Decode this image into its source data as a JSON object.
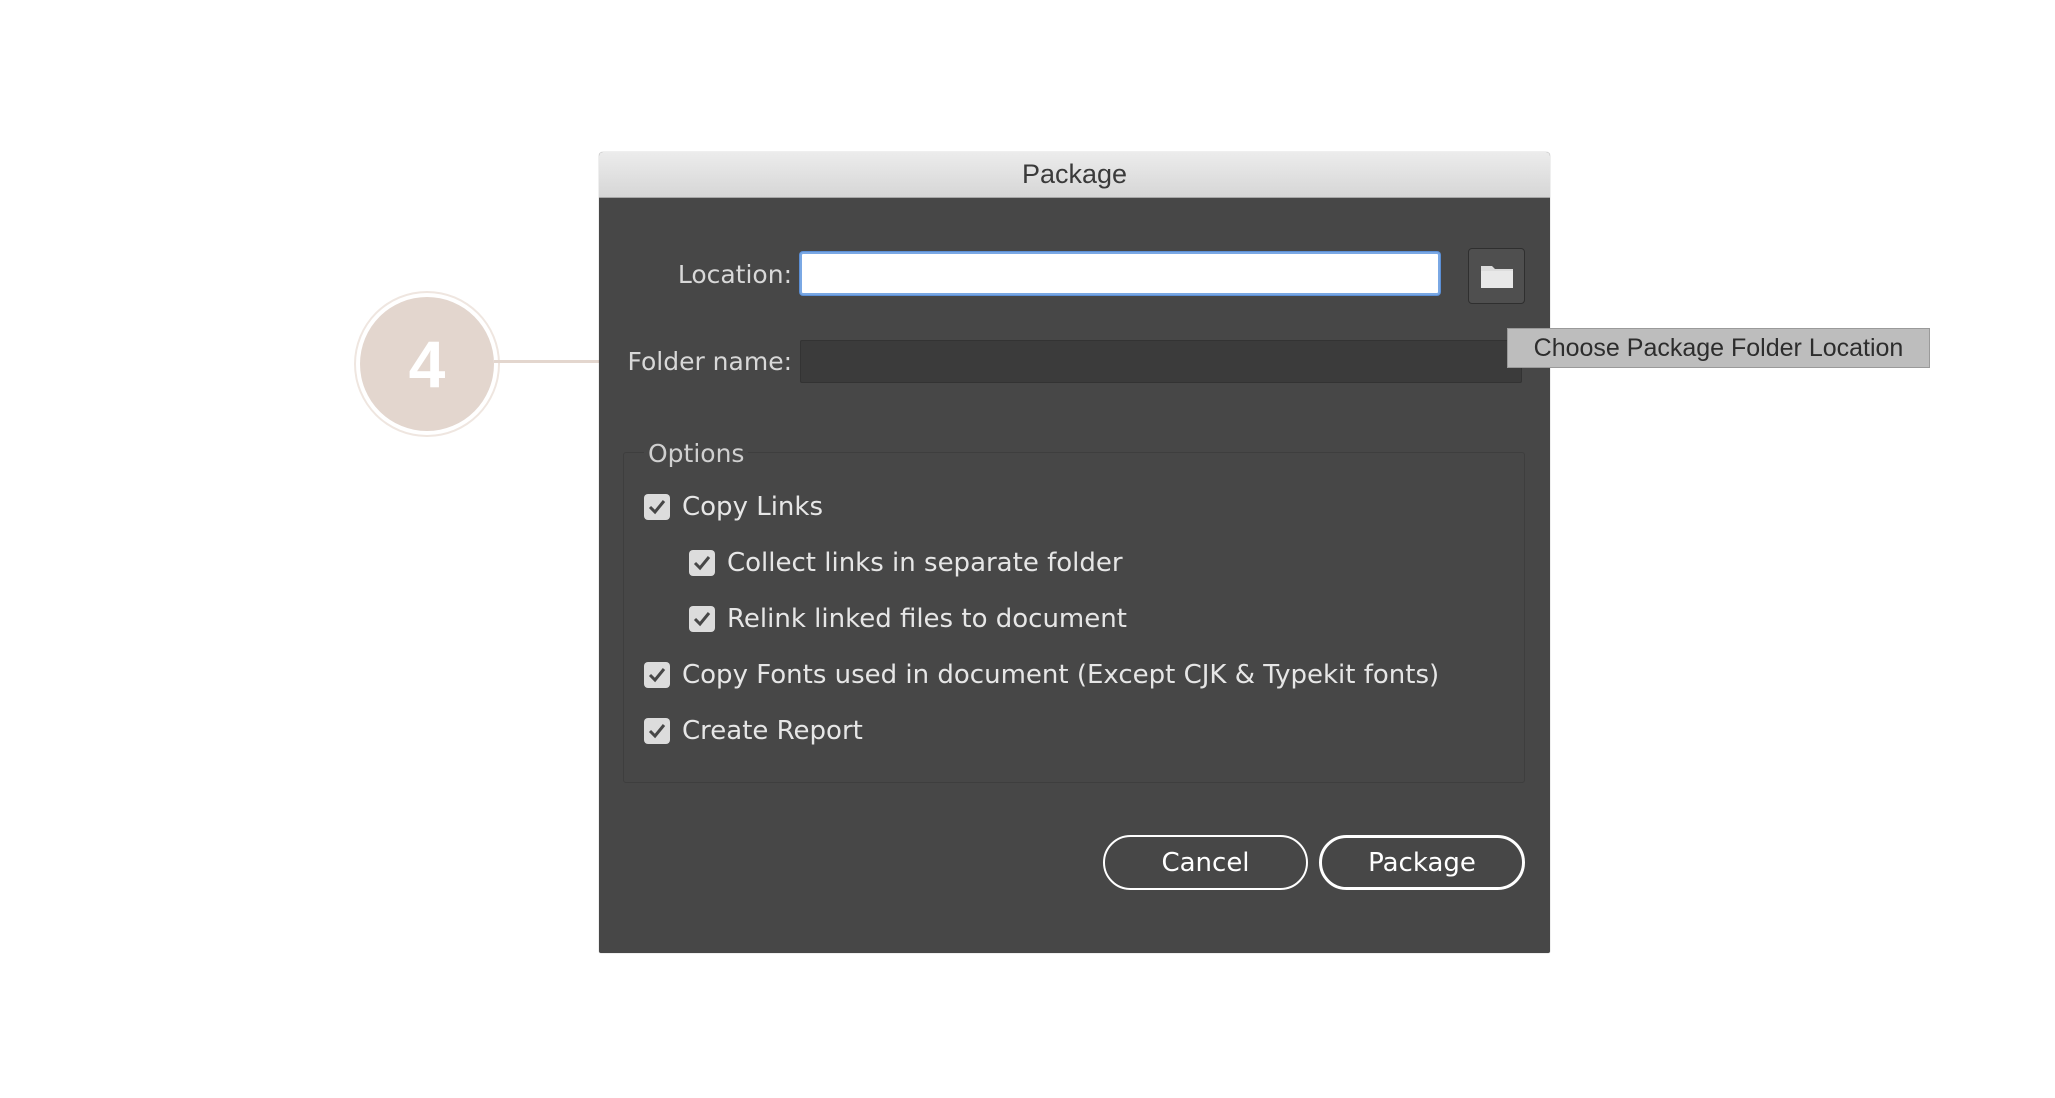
{
  "step_badge": {
    "number": "4"
  },
  "dialog": {
    "title": "Package",
    "location": {
      "label": "Location:",
      "value": ""
    },
    "folder_name": {
      "label": "Folder name:",
      "value": ""
    },
    "browse_icon": "folder-icon",
    "options": {
      "title": "Options",
      "items": [
        {
          "label": "Copy Links",
          "checked": true,
          "indent": 0
        },
        {
          "label": "Collect links in separate folder",
          "checked": true,
          "indent": 1
        },
        {
          "label": "Relink linked files to document",
          "checked": true,
          "indent": 1
        },
        {
          "label": "Copy Fonts used in document (Except CJK & Typekit fonts)",
          "checked": true,
          "indent": 0
        },
        {
          "label": "Create Report",
          "checked": true,
          "indent": 0
        }
      ]
    },
    "buttons": {
      "cancel": "Cancel",
      "package": "Package"
    }
  },
  "tooltip": {
    "text": "Choose Package Folder Location"
  },
  "colors": {
    "dialog_bg": "#474747",
    "step_badge": "#e3d6ce",
    "focus_ring": "#7aa8e4"
  }
}
